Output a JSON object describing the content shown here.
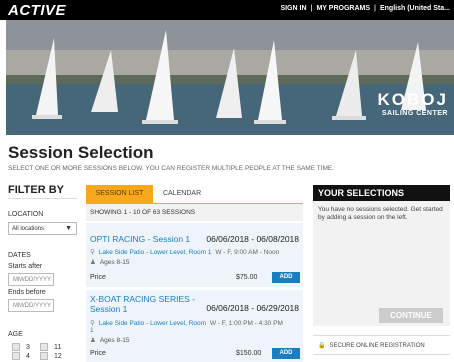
{
  "header": {
    "logo": "ACTIVE",
    "nav": [
      "SIGN IN",
      "MY PROGRAMS",
      "English (United Sta..."
    ],
    "sep": "|"
  },
  "banner": {
    "brand_main": "KOBOJ",
    "brand_sub": "SAILING CENTER"
  },
  "page": {
    "title": "Session Selection",
    "subtitle": "Select one or more sessions below. You can register multiple people at the same time."
  },
  "filter": {
    "title": "FILTER BY",
    "location_label": "LOCATION",
    "location_value": "All locations",
    "dates_label": "DATES",
    "starts_after_label": "Starts after",
    "starts_after_placeholder": "MM/DD/YYYY",
    "ends_before_label": "Ends before",
    "ends_before_placeholder": "MM/DD/YYYY",
    "age_label": "AGE",
    "ages_col1": [
      "3",
      "4"
    ],
    "ages_col2": [
      "11",
      "12"
    ]
  },
  "tabs": {
    "list": "Session list",
    "calendar": "Calendar"
  },
  "showing": "Showing 1 - 10 of 63 sessions",
  "sessions": [
    {
      "name": "OPTI RACING - Session 1",
      "dates": "06/06/2018 - 06/08/2018",
      "location": "Lake Side Patio - Lower Level, Room 1",
      "time": "W - F, 9:00 AM - Noon",
      "ages": "Ages 8-15",
      "price_label": "Price",
      "price": "$75.00",
      "add": "ADD"
    },
    {
      "name_line1": "X-BOAT RACING SERIES -",
      "name_line2": "Session 1",
      "dates": "06/06/2018 - 06/29/2018",
      "location": "Lake Side Patio - Lower Level, Room",
      "time": "W - F, 1:00 PM - 4:30 PM",
      "location_cont": "1",
      "ages": "Ages 8-15",
      "price_label": "Price",
      "price": "$150.00",
      "add": "ADD"
    }
  ],
  "selections": {
    "title": "YOUR SELECTIONS",
    "message": "You have no sessions selected. Get started by adding a session on the left.",
    "continue": "CONTINUE",
    "secure": "SECURE ONLINE REGISTRATION"
  },
  "icons": {
    "pin": "location-pin-icon",
    "person": "person-icon",
    "lock": "lock-icon",
    "dropdown": "chevron-down-icon"
  },
  "colors": {
    "accent": "#f7a81b",
    "link": "#1a7fc1",
    "header_bg": "#000000"
  }
}
